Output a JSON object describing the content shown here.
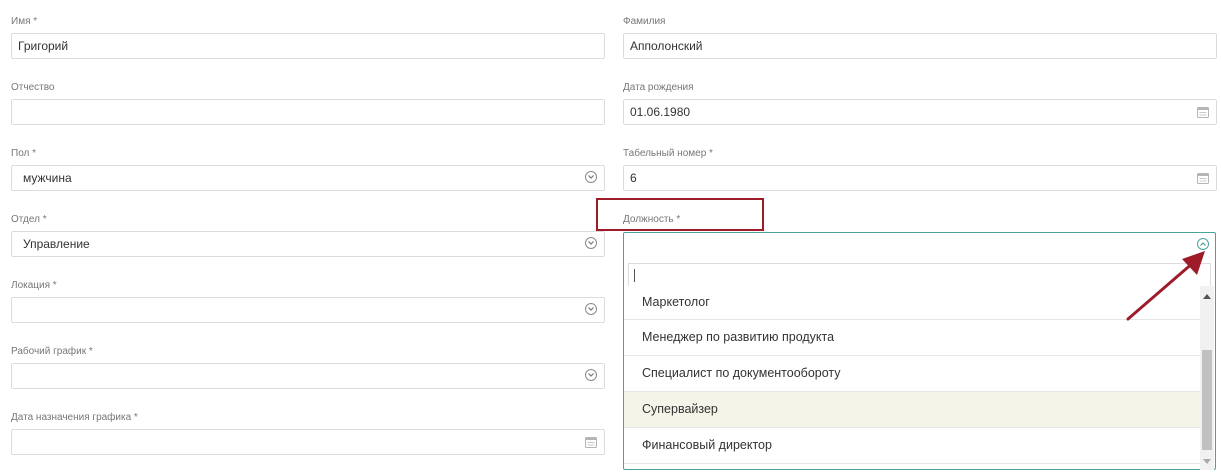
{
  "form": {
    "first_name": {
      "label": "Имя *",
      "value": "Григорий"
    },
    "last_name": {
      "label": "Фамилия",
      "value": "Апполонский"
    },
    "middle_name": {
      "label": "Отчество",
      "value": ""
    },
    "birth_date": {
      "label": "Дата рождения",
      "value": "01.06.1980"
    },
    "gender": {
      "label": "Пол *",
      "value": "мужчина"
    },
    "employee_number": {
      "label": "Табельный номер *",
      "value": "6"
    },
    "department": {
      "label": "Отдел *",
      "value": "Управление"
    },
    "position": {
      "label": "Должность *",
      "value": "",
      "search_value": "",
      "options": [
        "Маркетолог",
        "Менеджер по развитию продукта",
        "Специалист по документообороту",
        "Супервайзер",
        "Финансовый директор"
      ],
      "highlighted_option": "Супервайзер"
    },
    "location": {
      "label": "Локация *",
      "value": ""
    },
    "schedule": {
      "label": "Рабочий график *",
      "value": ""
    },
    "schedule_date": {
      "label": "Дата назначения графика *",
      "value": ""
    }
  },
  "icons": {
    "select": "chevron-down-circle-icon",
    "select_open": "chevron-up-circle-icon",
    "date": "calendar-icon"
  },
  "colors": {
    "annotation": "#9e1b2a",
    "focus_border": "#4aa39b",
    "option_highlight": "#f4f4e8"
  }
}
